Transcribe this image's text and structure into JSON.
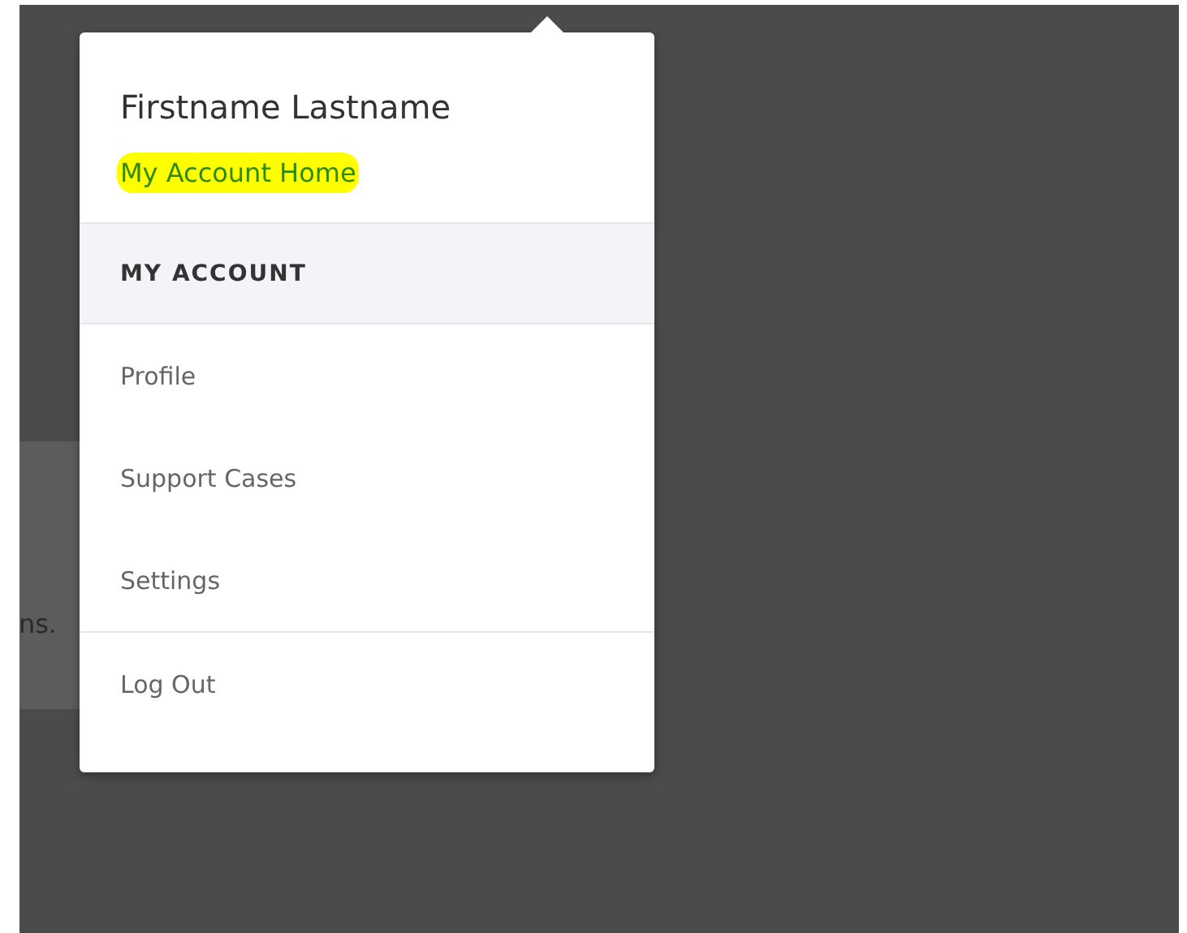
{
  "background_panel": {
    "text": "ns."
  },
  "account_menu": {
    "user_name": "Firstname Lastname",
    "home_link": {
      "label": "My Account Home",
      "highlighted": true
    },
    "section_title": "MY ACCOUNT",
    "items": [
      {
        "label": "Profile"
      },
      {
        "label": "Support Cases"
      },
      {
        "label": "Settings"
      }
    ],
    "footer_items": [
      {
        "label": "Log Out"
      }
    ]
  }
}
